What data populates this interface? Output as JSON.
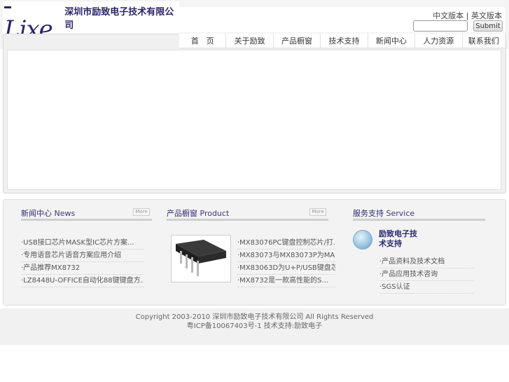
{
  "logo": {
    "mark": "Lixe",
    "company_name": "深圳市励致电子技术有限公司"
  },
  "toolbar": {
    "lang_cn": "中文版本",
    "lang_sep": "|",
    "lang_en": "英文版本",
    "submit_label": "Submit"
  },
  "nav": {
    "items": [
      "首　页",
      "关于励致",
      "产品橱窗",
      "技术支持",
      "新闻中心",
      "人力资源",
      "联系我们"
    ]
  },
  "news": {
    "title_zh": "新闻中心",
    "title_en": "News",
    "more_label": "More",
    "items": [
      "·USB接口芯片MASK型IC芯片方案...",
      "·专用语音芯片语音方案应用介绍",
      "·产品推荐MX8732",
      "·LZ8448U-OFFICE自动化88键键盘方..."
    ]
  },
  "product": {
    "title_zh": "产品橱窗",
    "title_en": "Product",
    "more_label": "More",
    "items": [
      "·MX83076PC键盘控制芯片/打...",
      "·MX83073与MX83073P为MASK...",
      "·MX83063D为U+P/USB键盘芯...",
      "·MX8732是一款高性能的S..."
    ]
  },
  "service": {
    "title_zh": "服务支持",
    "title_en": "Service",
    "heading_line1": "励致电子技",
    "heading_line2": "术支持",
    "items": [
      "·产品资料及技术文档",
      "·产品应用技术咨询",
      "·SGS认证"
    ]
  },
  "footer": {
    "line1": "Copyright 2003-2010 深圳市励致电子技术有限公司 All Rights Reserved",
    "line2": "粤ICP备10067403号-1 技术支持:励致电子"
  }
}
